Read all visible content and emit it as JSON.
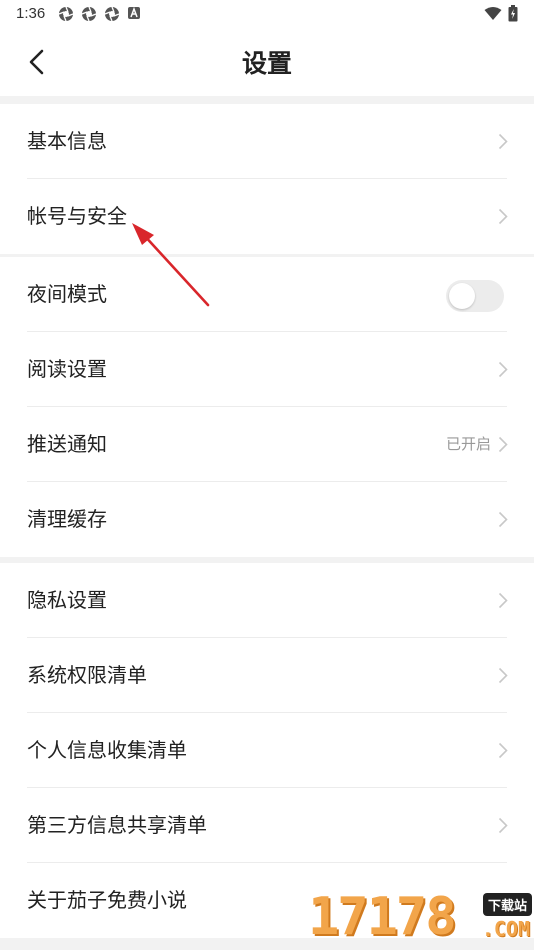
{
  "status_bar": {
    "time": "1:36",
    "notification_icons": [
      "aperture-icon",
      "aperture-icon",
      "aperture-icon",
      "a-badge-icon"
    ],
    "right_icons": [
      "wifi-icon",
      "battery-charging-icon"
    ]
  },
  "header": {
    "title": "设置",
    "back_icon": "chevron-left-icon"
  },
  "groups": [
    {
      "items": [
        {
          "label": "基本信息",
          "type": "link"
        },
        {
          "label": "帐号与安全",
          "type": "link"
        }
      ]
    },
    {
      "items": [
        {
          "label": "夜间模式",
          "type": "toggle",
          "on": false
        },
        {
          "label": "阅读设置",
          "type": "link"
        },
        {
          "label": "推送通知",
          "type": "link",
          "value": "已开启"
        },
        {
          "label": "清理缓存",
          "type": "link"
        }
      ]
    },
    {
      "items": [
        {
          "label": "隐私设置",
          "type": "link"
        },
        {
          "label": "系统权限清单",
          "type": "link"
        },
        {
          "label": "个人信息收集清单",
          "type": "link"
        },
        {
          "label": "第三方信息共享清单",
          "type": "link"
        },
        {
          "label": "关于茄子免费小说",
          "type": "link"
        }
      ]
    }
  ],
  "annotation": {
    "arrow_color": "#d9262b"
  },
  "watermark": {
    "number": "17178",
    "badge": "下载站",
    "suffix": ".COM"
  },
  "colors": {
    "background": "#f2f2f2",
    "row_background": "#ffffff",
    "chevron": "#c8c8c8",
    "value_text": "#999999",
    "watermark_orange": "#f2a54a"
  }
}
